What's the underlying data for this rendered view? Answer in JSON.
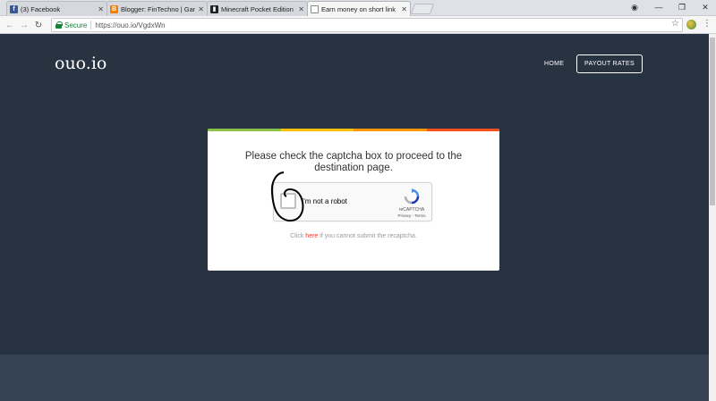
{
  "browser": {
    "tabs": [
      {
        "title": "(3) Facebook",
        "icon": "facebook-icon",
        "color": "#3b5998",
        "glyph": "f"
      },
      {
        "title": "Blogger: FinTechno | Gam",
        "icon": "blogger-icon",
        "color": "#f57d00",
        "glyph": "B"
      },
      {
        "title": "Minecraft Pocket Edition",
        "icon": "minecraft-icon",
        "color": "#222222",
        "glyph": "M"
      },
      {
        "title": "Earn money on short link",
        "icon": "page-icon",
        "color": "#ffffff",
        "glyph": ""
      }
    ],
    "address": {
      "secure_label": "Secure",
      "url": "https://ouo.io/VgdxWn"
    }
  },
  "site": {
    "logo": "ouo.io",
    "nav_home": "HOME",
    "nav_payout": "PAYOUT RATES"
  },
  "card": {
    "message": "Please check the captcha box to proceed to the destination page.",
    "captcha_label": "I'm not a robot",
    "recaptcha_name": "reCAPTCHA",
    "recaptcha_terms": "Privacy - Terms",
    "hint_prefix": "Click ",
    "hint_link": "here",
    "hint_suffix": " if you cannot submit the recaptcha.",
    "stripe_colors": [
      "#8bc34a",
      "#ffc107",
      "#ff9800",
      "#f4511e"
    ]
  }
}
